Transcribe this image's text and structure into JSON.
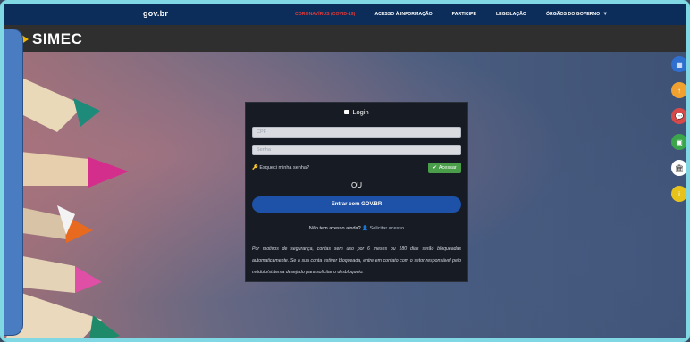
{
  "gov_bar": {
    "logo": "gov.br",
    "links": [
      {
        "label": "CORONAVÍRUS (COVID-19)",
        "color": "#e03a3a"
      },
      {
        "label": "ACESSO À INFORMAÇÃO"
      },
      {
        "label": "PARTICIPE"
      },
      {
        "label": "LEGISLAÇÃO"
      },
      {
        "label": "ÓRGÃOS DO GOVERNO"
      }
    ]
  },
  "brand": {
    "name": "SIMEC",
    "accent": "#f2b705"
  },
  "login": {
    "title": "Login",
    "cpf_placeholder": "CPF",
    "password_placeholder": "Senha",
    "forgot_label": "Esqueci minha senha?",
    "submit_label": "Acessar",
    "or_label": "OU",
    "govbr_button_label": "Entrar com GOV.BR",
    "no_access_question": "Não tem acesso ainda?",
    "request_access_link": "Solicitar acesso",
    "notice": "Por motivos de segurança, contas sem uso por 6 meses ou 180 dias serão bloqueadas automaticamente. Se a sua conta estiver bloqueada, entre em contato com o setor responsável pelo módulo/sistema desejado para solicitar o desbloqueio."
  },
  "floating_buttons": [
    {
      "name": "grid",
      "color": "#2f6fd0",
      "glyph": "▦"
    },
    {
      "name": "upload",
      "color": "#f0a12f",
      "glyph": "↑"
    },
    {
      "name": "chat",
      "color": "#d84a4a",
      "glyph": "💬"
    },
    {
      "name": "message",
      "color": "#3aa54a",
      "glyph": "▣"
    },
    {
      "name": "institution",
      "color": "#ffffff",
      "glyph": "🏛"
    },
    {
      "name": "info",
      "color": "#e6c21a",
      "glyph": "i"
    }
  ]
}
